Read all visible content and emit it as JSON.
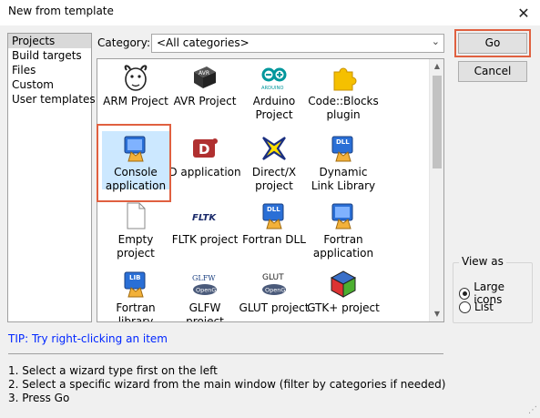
{
  "window": {
    "title": "New from template",
    "close_glyph": "✕"
  },
  "categories": {
    "items": [
      "Projects",
      "Build targets",
      "Files",
      "Custom",
      "User templates"
    ],
    "selected": "Projects"
  },
  "filter": {
    "label": "Category:",
    "value": "<All categories>"
  },
  "templates": [
    {
      "label": "ARM Project",
      "icon": "arm-gnu-icon"
    },
    {
      "label": "AVR Project",
      "icon": "avr-chip-icon"
    },
    {
      "label": "Arduino Project",
      "icon": "arduino-icon"
    },
    {
      "label": "Code::Blocks plugin",
      "icon": "puzzle-piece-icon"
    },
    {
      "label": "Console application",
      "icon": "console-app-icon",
      "selected": true
    },
    {
      "label": "D application",
      "icon": "d-lang-icon"
    },
    {
      "label": "Direct/X project",
      "icon": "directx-icon"
    },
    {
      "label": "Dynamic Link Library",
      "icon": "dll-icon"
    },
    {
      "label": "Empty project",
      "icon": "blank-page-icon"
    },
    {
      "label": "FLTK project",
      "icon": "fltk-icon"
    },
    {
      "label": "Fortran DLL",
      "icon": "fortran-dll-icon"
    },
    {
      "label": "Fortran application",
      "icon": "fortran-app-icon"
    },
    {
      "label": "Fortran library",
      "icon": "fortran-lib-icon"
    },
    {
      "label": "GLFW project",
      "icon": "glfw-icon"
    },
    {
      "label": "GLUT project",
      "icon": "glut-icon"
    },
    {
      "label": "GTK+ project",
      "icon": "gtk-cube-icon"
    }
  ],
  "buttons": {
    "go": "Go",
    "cancel": "Cancel"
  },
  "view_as": {
    "legend": "View as",
    "large_icons": "Large icons",
    "list": "List",
    "selected": "Large icons"
  },
  "tip": "TIP: Try right-clicking an item",
  "instructions": [
    "1. Select a wizard type first on the left",
    "2. Select a specific wizard from the main window (filter by categories if needed)",
    "3. Press Go"
  ],
  "icon_text": {
    "avr": "AVR",
    "arduino": "ARDUINO",
    "d": "D",
    "dll": "DLL",
    "fltk": "FLTK",
    "lib": "LIB",
    "glfw": "GLFW",
    "glut": "GLUT",
    "opengl": "OpenGL"
  },
  "colors": {
    "highlight": "#e06040",
    "tip": "#0026ff",
    "selection": "#cce8ff",
    "arduino": "#00979c"
  }
}
